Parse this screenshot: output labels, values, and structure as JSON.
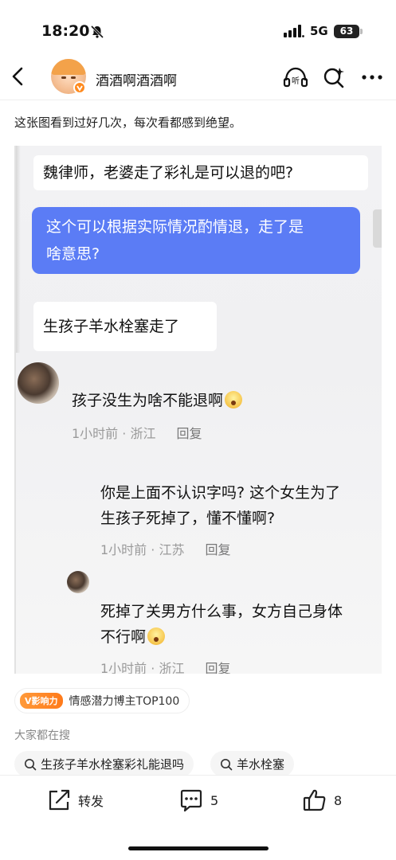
{
  "status_bar": {
    "time": "18:20",
    "network": "5G",
    "battery": "63"
  },
  "nav": {
    "username": "酒酒啊酒酒啊"
  },
  "post": {
    "caption": "这张图看到过好几次，每次看都感到绝望。"
  },
  "screenshot": {
    "msg1": "魏律师，老婆走了彩礼是可以退的吧?",
    "msg2_line1": "这个可以根据实际情况酌情退，走了是",
    "msg2_line2": "啥意思?",
    "msg3": "生孩子羊水栓塞走了",
    "comment1": {
      "text": "孩子没生为啥不能退啊",
      "time": "1小时前 · 浙江",
      "reply": "回复"
    },
    "comment2": {
      "line1": "你是上面不认识字吗? 这个女生为了",
      "line2": "生孩子死掉了，懂不懂啊?",
      "time": "1小时前 · 江苏",
      "reply": "回复"
    },
    "comment3": {
      "line1": "死掉了关男方什么事，女方自己身体",
      "line2": "不行啊",
      "time": "1小时前 · 浙江",
      "reply": "回复"
    }
  },
  "tag": {
    "badge": "V影响力",
    "text": "情感潜力博主TOP100"
  },
  "search": {
    "heading": "大家都在搜",
    "chips": [
      "生孩子羊水栓塞彩礼能退吗",
      "羊水栓塞"
    ]
  },
  "actions": {
    "share_label": "转发",
    "comment_count": "5",
    "like_count": "8"
  },
  "colors": {
    "bubble_blue": "#5b7cf5",
    "accent_orange": "#ff8a1e"
  },
  "icons": [
    "back-icon",
    "listen-icon",
    "search-icon",
    "more-icon",
    "share-icon",
    "comment-icon",
    "like-icon"
  ]
}
